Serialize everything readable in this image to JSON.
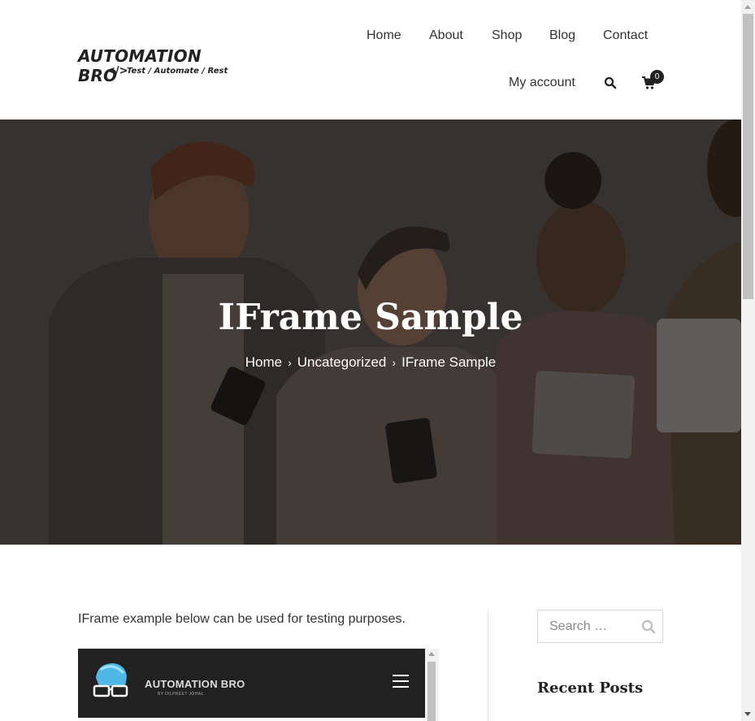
{
  "logo": {
    "title": "AUTOMATION BRO",
    "code_glyph": "</>",
    "tagline": "Test / Automate / Rest"
  },
  "nav": {
    "home": "Home",
    "about": "About",
    "shop": "Shop",
    "blog": "Blog",
    "contact": "Contact",
    "my_account": "My account",
    "cart_count": "0"
  },
  "hero": {
    "title": "IFrame Sample",
    "breadcrumb": [
      "Home",
      "Uncategorized",
      "IFrame Sample"
    ],
    "separator": "›"
  },
  "content": {
    "intro": "IFrame example below can be used for testing purposes.",
    "iframe": {
      "brand": "AUTOMATION BRO",
      "brand_sub": "BY DILPREET JOHAL"
    }
  },
  "sidebar": {
    "search_placeholder": "Search …",
    "recent_posts_heading": "Recent Posts"
  },
  "colors": {
    "header_bg": "#ffffff",
    "hero_overlay": "#3e3b38",
    "iframe_bg": "#212121",
    "text": "#333333"
  }
}
